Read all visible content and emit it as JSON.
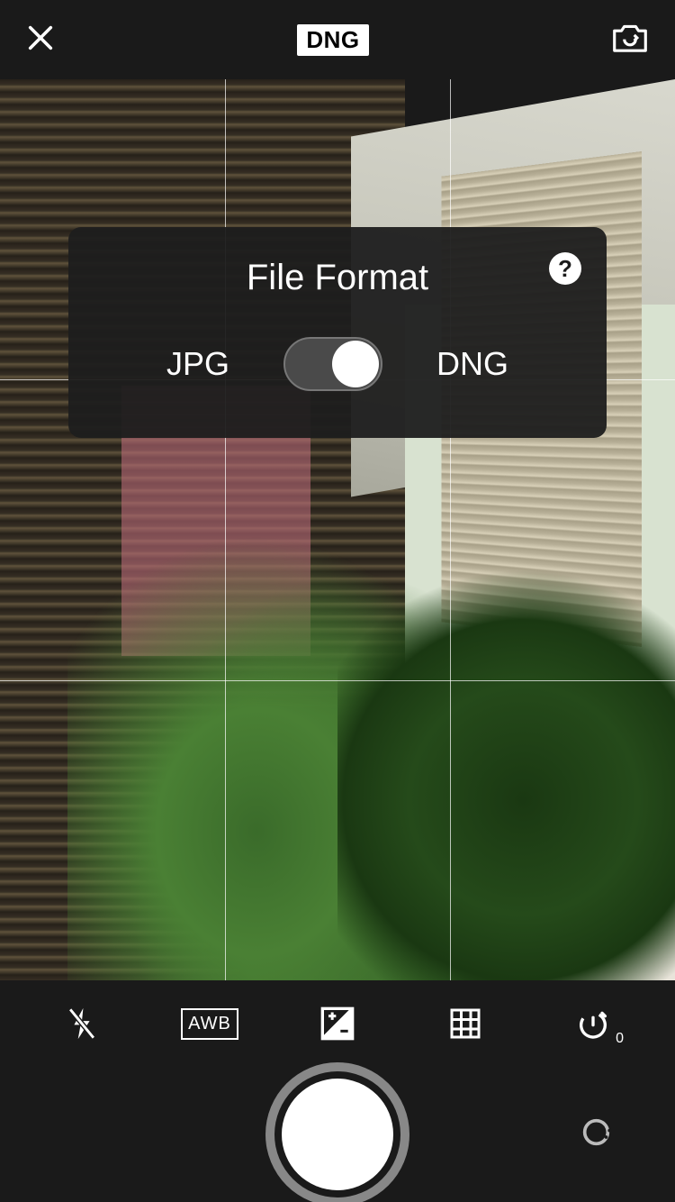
{
  "topbar": {
    "format_badge": "DNG"
  },
  "panel": {
    "title": "File Format",
    "help_label": "?",
    "option_left": "JPG",
    "option_right": "DNG",
    "selected": "DNG"
  },
  "controls": {
    "wb_label": "AWB",
    "timer_value": "0"
  },
  "icons": {
    "close": "close-icon",
    "switch_camera": "switch-camera-icon",
    "flash_off": "flash-off-icon",
    "exposure": "exposure-compensation-icon",
    "grid": "grid-icon",
    "timer": "timer-icon",
    "filter": "filter-icon"
  }
}
